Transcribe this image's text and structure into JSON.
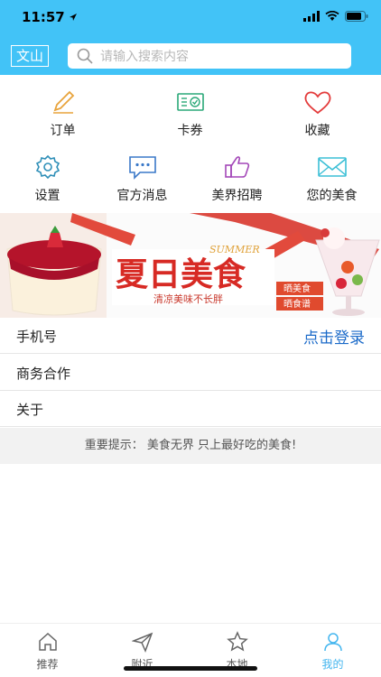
{
  "status_bar": {
    "time": "11:57"
  },
  "header": {
    "city": "文山",
    "search_placeholder": "请输入搜索内容"
  },
  "grid": {
    "items": [
      {
        "label": "订单",
        "icon": "pencil-icon",
        "color": "#e8a33b"
      },
      {
        "label": "卡券",
        "icon": "coupon-icon",
        "color": "#2aa878"
      },
      {
        "label": "收藏",
        "icon": "heart-icon",
        "color": "#e33b3b"
      },
      {
        "label": "设置",
        "icon": "gear-icon",
        "color": "#2f8fb8"
      },
      {
        "label": "官方消息",
        "icon": "message-icon",
        "color": "#3a78c8"
      },
      {
        "label": "美界招聘",
        "icon": "thumbs-up-icon",
        "color": "#a347b8"
      },
      {
        "label": "您的美食",
        "icon": "mail-icon",
        "color": "#3bbfd6"
      }
    ]
  },
  "banner": {
    "title": "夏日美食",
    "subtitle": "SUMMER",
    "slogan": "清凉美味不长胖",
    "tags": [
      "晒美食",
      "晒食谱"
    ]
  },
  "list": {
    "phone_label": "手机号",
    "login_label": "点击登录",
    "business_label": "商务合作",
    "about_label": "关于"
  },
  "tip": "重要提示：  美食无界  只上最好吃的美食!",
  "tabbar": {
    "items": [
      {
        "label": "推荐",
        "icon": "home-icon",
        "active": false
      },
      {
        "label": "附近",
        "icon": "send-icon",
        "active": false
      },
      {
        "label": "本地",
        "icon": "star-icon",
        "active": false
      },
      {
        "label": "我的",
        "icon": "person-icon",
        "active": true
      }
    ]
  },
  "colors": {
    "header": "#42c3f7",
    "accent": "#1b6ac9",
    "tab_active": "#42b5ef"
  }
}
